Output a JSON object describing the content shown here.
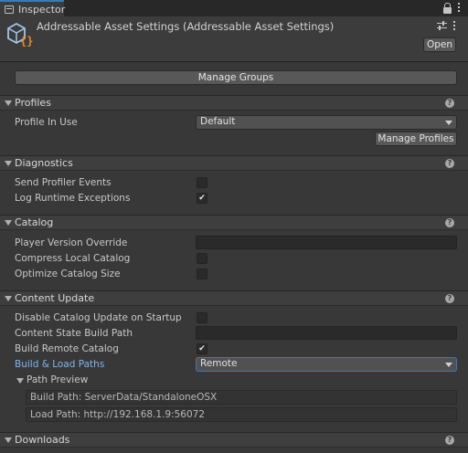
{
  "tab": {
    "label": "Inspector"
  },
  "header": {
    "title": "Addressable Asset Settings (Addressable Asset Settings)",
    "open_label": "Open",
    "asset_icon": "addressables-asset-icon"
  },
  "toolbar": {
    "manage_groups_label": "Manage Groups"
  },
  "profiles": {
    "title": "Profiles",
    "profile_in_use_label": "Profile In Use",
    "profile_in_use_value": "Default",
    "manage_profiles_label": "Manage Profiles"
  },
  "diagnostics": {
    "title": "Diagnostics",
    "send_profiler_events_label": "Send Profiler Events",
    "send_profiler_events_checked": false,
    "log_runtime_exceptions_label": "Log Runtime Exceptions",
    "log_runtime_exceptions_checked": true
  },
  "catalog": {
    "title": "Catalog",
    "player_version_override_label": "Player Version Override",
    "player_version_override_value": "",
    "compress_local_catalog_label": "Compress Local Catalog",
    "compress_local_catalog_checked": false,
    "optimize_catalog_size_label": "Optimize Catalog Size",
    "optimize_catalog_size_checked": false
  },
  "content_update": {
    "title": "Content Update",
    "disable_catalog_update_label": "Disable Catalog Update on Startup",
    "disable_catalog_update_checked": false,
    "content_state_build_path_label": "Content State Build Path",
    "content_state_build_path_value": "",
    "build_remote_catalog_label": "Build Remote Catalog",
    "build_remote_catalog_checked": true,
    "build_load_paths_label": "Build & Load Paths",
    "build_load_paths_value": "Remote",
    "path_preview_label": "Path Preview",
    "build_path_text": "Build Path: ServerData/StandaloneOSX",
    "load_path_text": "Load Path: http://192.168.1.9:56072"
  },
  "downloads": {
    "title": "Downloads"
  },
  "colors": {
    "accent": "#3a79bb",
    "highlight_label": "#7db5f0"
  }
}
